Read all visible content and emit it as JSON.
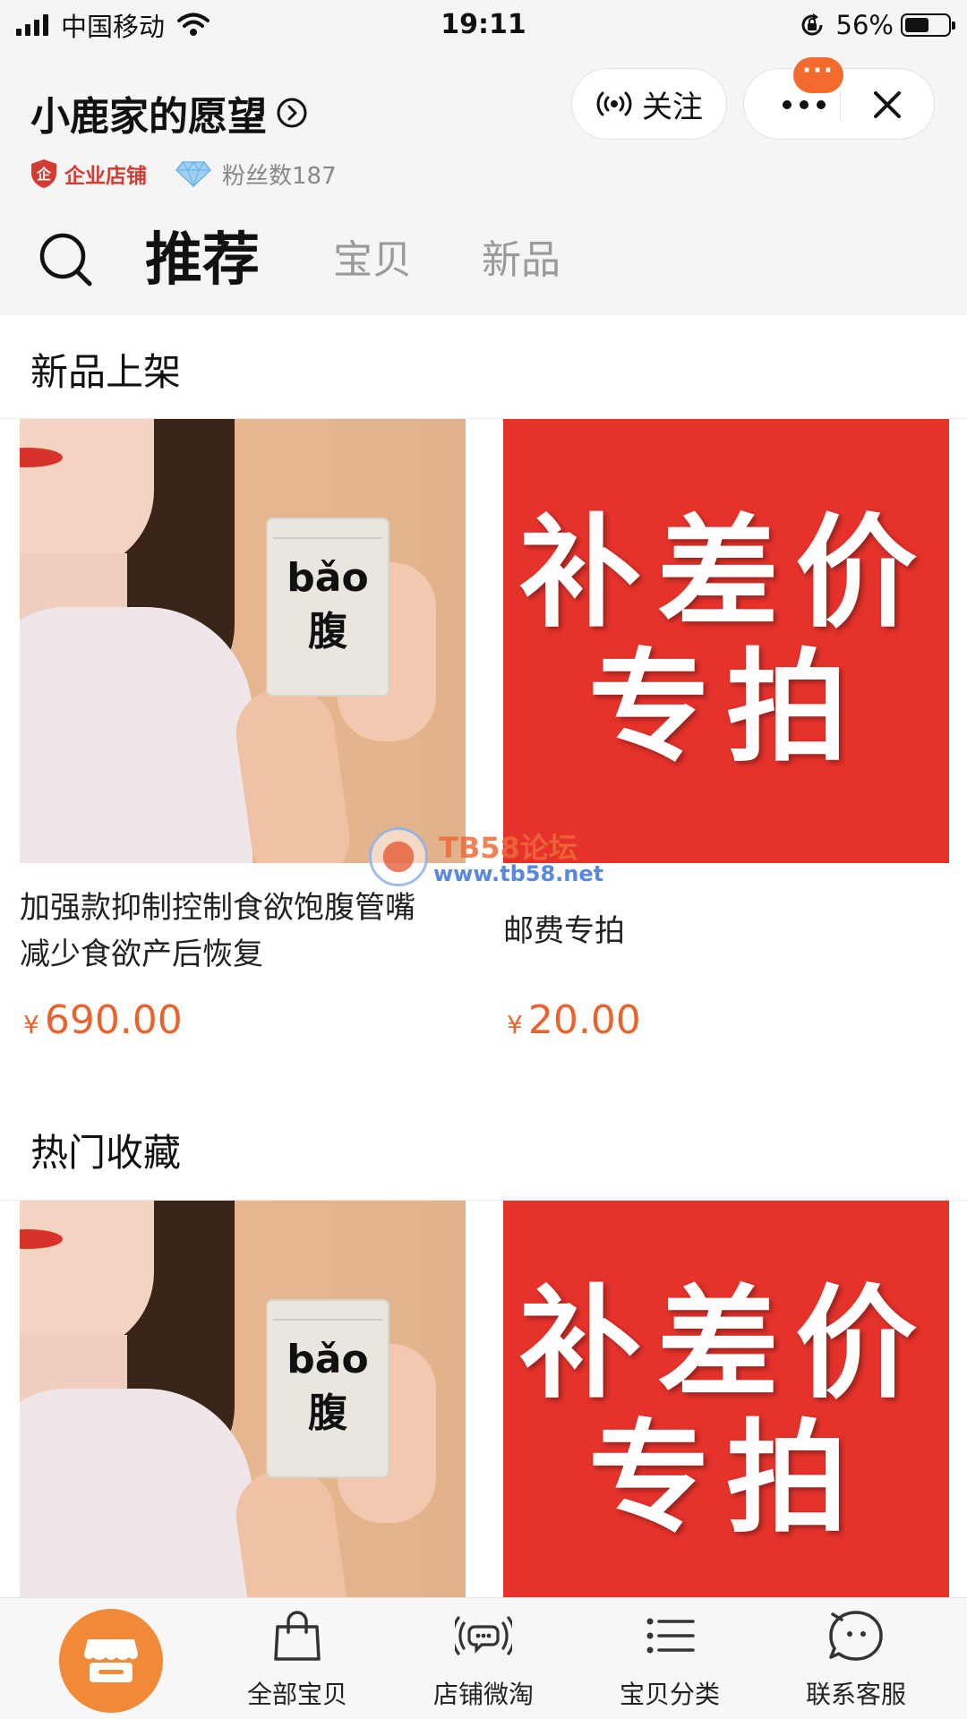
{
  "status_bar": {
    "carrier": "中国移动",
    "time": "19:11",
    "battery": "56%",
    "battery_level": 0.56
  },
  "header": {
    "shop_name": "小鹿家的愿望",
    "follow_label": "关注",
    "notification_badge": "···",
    "enterprise_badge": "企业店铺",
    "fans_label": "粉丝数187"
  },
  "tabs": [
    {
      "label": "推荐",
      "active": true
    },
    {
      "label": "宝贝",
      "active": false
    },
    {
      "label": "新品",
      "active": false
    }
  ],
  "sections": {
    "new_arrivals": {
      "title": "新品上架",
      "products": [
        {
          "image_text_1": "bǎo",
          "image_text_2": "腹",
          "title": "加强款抑制控制食欲饱腹管嘴减少食欲产后恢复",
          "currency": "¥",
          "price": "690.00"
        },
        {
          "image_text_1": "补差价",
          "image_text_2": "专拍",
          "title": "邮费专拍",
          "currency": "¥",
          "price": "20.00"
        }
      ]
    },
    "hot_favorites": {
      "title": "热门收藏",
      "products": [
        {
          "image_text_1": "bǎo",
          "image_text_2": "腹"
        },
        {
          "image_text_1": "补差价",
          "image_text_2": "专拍"
        }
      ]
    }
  },
  "watermark": {
    "line1": "TB58论坛",
    "line2": "www.tb58.net"
  },
  "bottom_nav": [
    {
      "label": "全部宝贝",
      "icon": "shopping-bag-icon"
    },
    {
      "label": "店铺微淘",
      "icon": "broadcast-chat-icon"
    },
    {
      "label": "宝贝分类",
      "icon": "list-icon"
    },
    {
      "label": "联系客服",
      "icon": "chat-bubble-icon"
    }
  ],
  "colors": {
    "accent": "#f26b2d",
    "price": "#e8632e",
    "promo_red": "#e5322b",
    "enterprise_red": "#d43c33"
  }
}
